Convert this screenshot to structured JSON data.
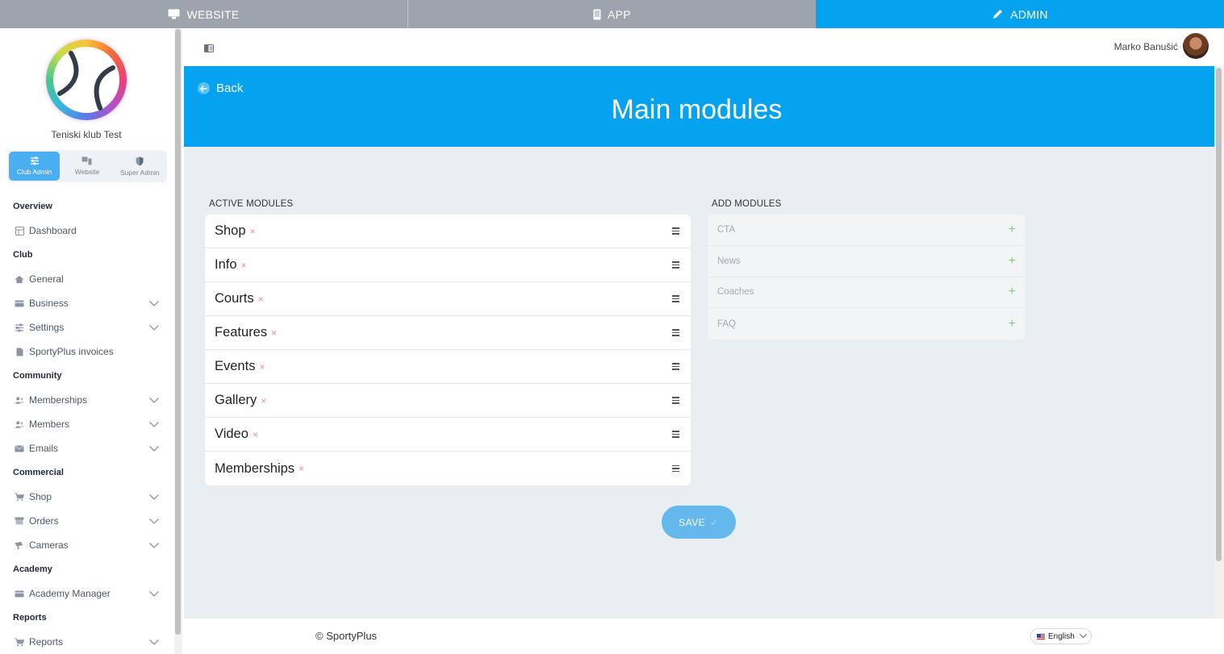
{
  "topbar": {
    "tabs": [
      {
        "label": "WEBSITE",
        "icon": "monitor-icon",
        "active": false
      },
      {
        "label": "APP",
        "icon": "mobile-icon",
        "active": false
      },
      {
        "label": "ADMIN",
        "icon": "pencil-icon",
        "active": true
      }
    ]
  },
  "colors": {
    "accent": "#04a2ef",
    "tab_inactive": "#9ea4ad",
    "content_bg": "#e9eef3",
    "remove": "#f08a98",
    "add": "#8cc68c"
  },
  "sidebar": {
    "club_name": "Teniski klub Test",
    "roles": [
      {
        "label": "Club Admin",
        "icon": "sliders-icon",
        "active": true
      },
      {
        "label": "Website",
        "icon": "website-icon",
        "active": false
      },
      {
        "label": "Super Admin",
        "icon": "shield-icon",
        "active": false
      }
    ],
    "sections": [
      {
        "title": "Overview",
        "items": [
          {
            "label": "Dashboard",
            "icon": "dashboard-icon",
            "expandable": false
          }
        ]
      },
      {
        "title": "Club",
        "items": [
          {
            "label": "General",
            "icon": "home-icon",
            "expandable": false
          },
          {
            "label": "Business",
            "icon": "card-icon",
            "expandable": true
          },
          {
            "label": "Settings",
            "icon": "sliders-icon",
            "expandable": true
          },
          {
            "label": "SportyPlus invoices",
            "icon": "document-icon",
            "expandable": false
          }
        ]
      },
      {
        "title": "Community",
        "items": [
          {
            "label": "Memberships",
            "icon": "users-icon",
            "expandable": true
          },
          {
            "label": "Members",
            "icon": "users-icon",
            "expandable": true
          },
          {
            "label": "Emails",
            "icon": "envelope-icon",
            "expandable": true
          }
        ]
      },
      {
        "title": "Commercial",
        "items": [
          {
            "label": "Shop",
            "icon": "cart-icon",
            "expandable": true
          },
          {
            "label": "Orders",
            "icon": "box-icon",
            "expandable": true
          },
          {
            "label": "Cameras",
            "icon": "camera-icon",
            "expandable": true
          }
        ]
      },
      {
        "title": "Academy",
        "items": [
          {
            "label": "Academy Manager",
            "icon": "card-icon",
            "expandable": true
          }
        ]
      },
      {
        "title": "Reports",
        "items": [
          {
            "label": "Reports",
            "icon": "cart-icon",
            "expandable": true
          }
        ]
      }
    ]
  },
  "header": {
    "user_name": "Marko Banušić"
  },
  "main": {
    "back_label": "Back",
    "title": "Main modules",
    "active_label": "ACTIVE MODULES",
    "add_label": "ADD MODULES",
    "active_modules": [
      "Shop",
      "Info",
      "Courts",
      "Features",
      "Events",
      "Gallery",
      "Video",
      "Memberships"
    ],
    "available_modules": [
      "CTA",
      "News",
      "Coaches",
      "FAQ"
    ],
    "remove_glyph": "×",
    "add_glyph": "+",
    "save_label": "SAVE",
    "save_check": "✓"
  },
  "footer": {
    "copyright": "© SportyPlus",
    "language": "English"
  }
}
